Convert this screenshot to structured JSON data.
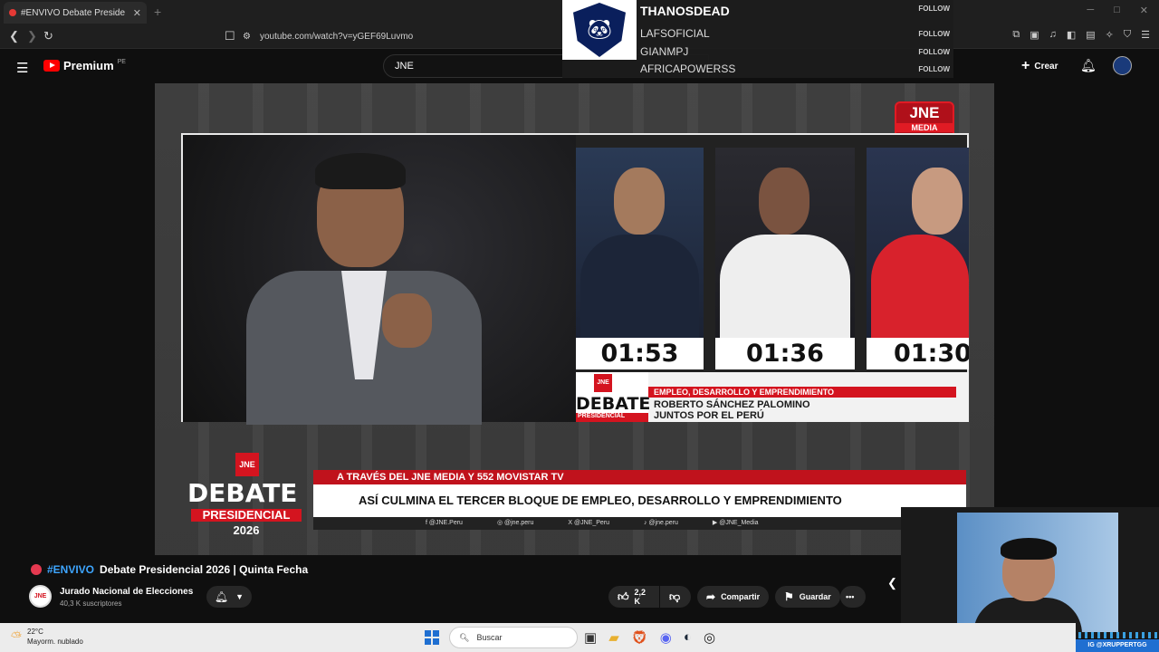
{
  "browser": {
    "tab_title": "#ENVIVO Debate Preside",
    "new_tab_symbol": "+",
    "url": "youtube.com/watch?v=yGEF69Luvmo",
    "window_controls": [
      "─",
      "□",
      "✕"
    ]
  },
  "follow_overlay": {
    "items": [
      {
        "name": "THANOSDEAD",
        "action": "FOLLOW"
      },
      {
        "name": "LAFSOFICIAL",
        "action": "FOLLOW"
      },
      {
        "name": "GIANMPJ",
        "action": "FOLLOW"
      },
      {
        "name": "AFRICAPOWERSS",
        "action": "FOLLOW"
      }
    ]
  },
  "youtube": {
    "logo_text": "Premium",
    "country": "PE",
    "search_value": "JNE",
    "create_label": "Crear"
  },
  "video": {
    "badge_top": "JNE",
    "badge_bottom": "MEDIA",
    "timers": [
      "01:53",
      "01:36",
      "01:30"
    ],
    "lower_third": {
      "mini_logo": "JNE",
      "word": "DEBATE",
      "sub": "PRESIDENCIAL",
      "topic": "EMPLEO, DESARROLLO Y EMPRENDIMIENTO",
      "name_line1": "ROBERTO SÁNCHEZ PALOMINO",
      "name_line2": "JUNTOS POR EL PERÚ"
    },
    "big_logo": {
      "mini": "JNE",
      "word": "DEBATE",
      "sub": "PRESIDENCIAL",
      "year": "2026"
    },
    "ticker": {
      "top": "A TRAVÉS DEL JNE MEDIA Y 552 MOVISTAR TV",
      "main": "ASÍ CULMINA EL TERCER BLOQUE DE EMPLEO, DESARROLLO Y EMPRENDIMIENTO",
      "socials": [
        "f  @JNE.Peru",
        "◎  @jne.peru",
        "X  @JNE_Peru",
        "♪  @jne.peru",
        "▶  @JNE_Media"
      ]
    }
  },
  "info": {
    "hashtag": "#ENVIVO",
    "title": "Debate Presidencial 2026 | Quinta Fecha",
    "channel_name": "Jurado Nacional de Elecciones",
    "channel_subs": "40,3 K suscriptores",
    "channel_avatar_text": "JNE",
    "likes": "2,2 K",
    "share_label": "Compartir",
    "save_label": "Guardar",
    "more": "•••"
  },
  "webcam": {
    "ig_tag": "IG @XRUPPERTGG"
  },
  "taskbar": {
    "temp": "22°C",
    "weather": "Mayorm. nublado",
    "search_placeholder": "Buscar"
  },
  "colors": {
    "jne_red": "#d4141f",
    "youtube_red": "#ff0000",
    "link_blue": "#3ea6ff"
  }
}
